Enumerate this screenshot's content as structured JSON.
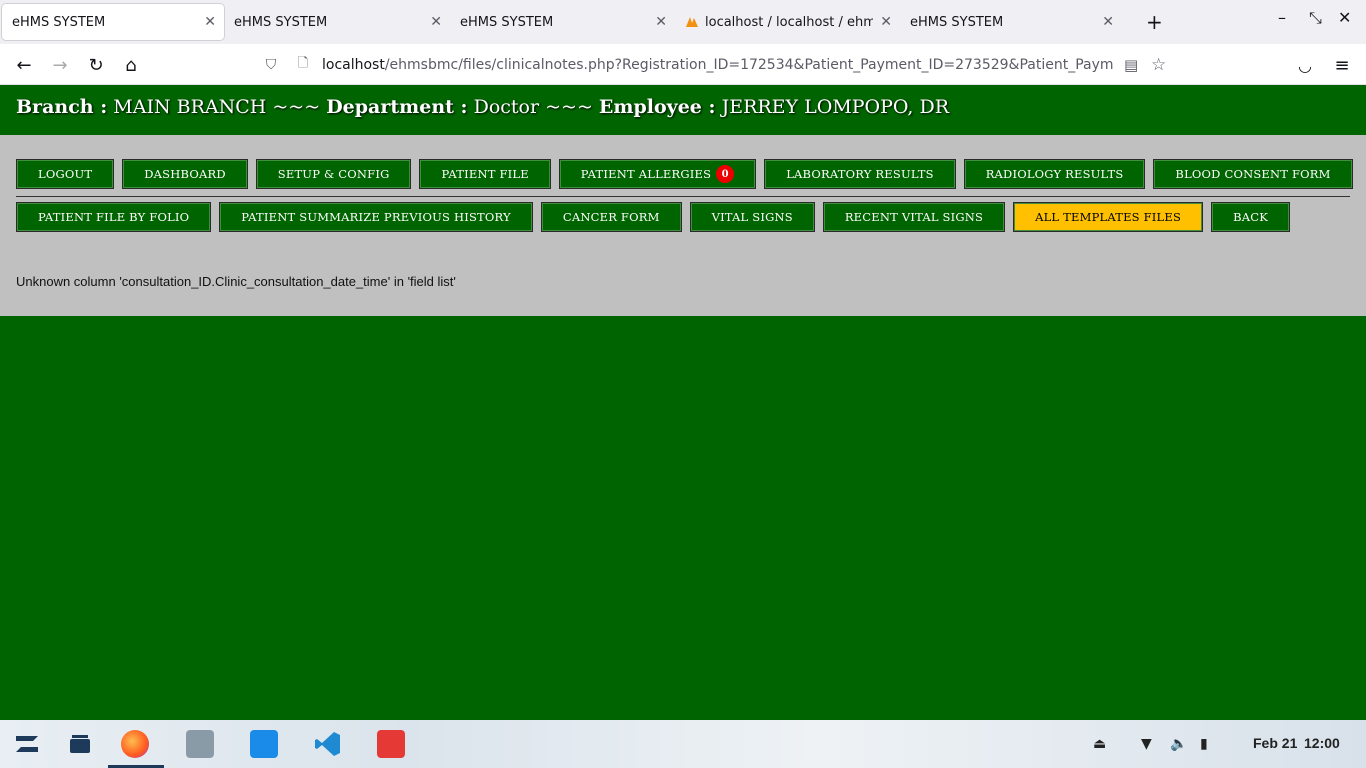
{
  "browser": {
    "tabs": [
      {
        "title": "eHMS SYSTEM",
        "active": true
      },
      {
        "title": "eHMS SYSTEM",
        "active": false
      },
      {
        "title": "eHMS SYSTEM",
        "active": false
      },
      {
        "title": "localhost / localhost / ehm",
        "active": false
      },
      {
        "title": "eHMS SYSTEM",
        "active": false
      }
    ],
    "url_host": "localhost",
    "url_path": "/ehmsbmc/files/clinicalnotes.php?Registration_ID=172534&Patient_Payment_ID=273529&Patient_Payment_Iten"
  },
  "header": {
    "branch_label": "Branch :",
    "branch_value": "MAIN BRANCH ~~~",
    "department_label": "Department :",
    "department_value": "Doctor ~~~",
    "employee_label": "Employee :",
    "employee_value": "JERREY LOMPOPO, DR"
  },
  "nav_row1": [
    {
      "label": "LOGOUT"
    },
    {
      "label": "DASHBOARD"
    },
    {
      "label": "SETUP & CONFIG"
    },
    {
      "label": "PATIENT FILE"
    },
    {
      "label": "PATIENT ALLERGIES",
      "badge": "0"
    },
    {
      "label": "LABORATORY RESULTS"
    },
    {
      "label": "RADIOLOGY RESULTS"
    },
    {
      "label": "BLOOD CONSENT FORM"
    }
  ],
  "nav_row2": [
    {
      "label": "PATIENT FILE BY FOLIO"
    },
    {
      "label": "PATIENT SUMMARIZE PREVIOUS HISTORY"
    },
    {
      "label": "CANCER FORM"
    },
    {
      "label": "VITAL SIGNS"
    },
    {
      "label": "RECENT VITAL SIGNS"
    },
    {
      "label": "ALL TEMPLATES FILES",
      "active": true
    },
    {
      "label": "BACK"
    }
  ],
  "error_message": "Unknown column 'consultation_ID.Clinic_consultation_date_time' in 'field list'",
  "taskbar": {
    "date": "Feb 21",
    "time": "12:00"
  },
  "colors": {
    "header_green": "#006400",
    "active_button": "#ffc000",
    "panel_grey": "#c0c0c0",
    "badge_red": "#ee0000"
  }
}
